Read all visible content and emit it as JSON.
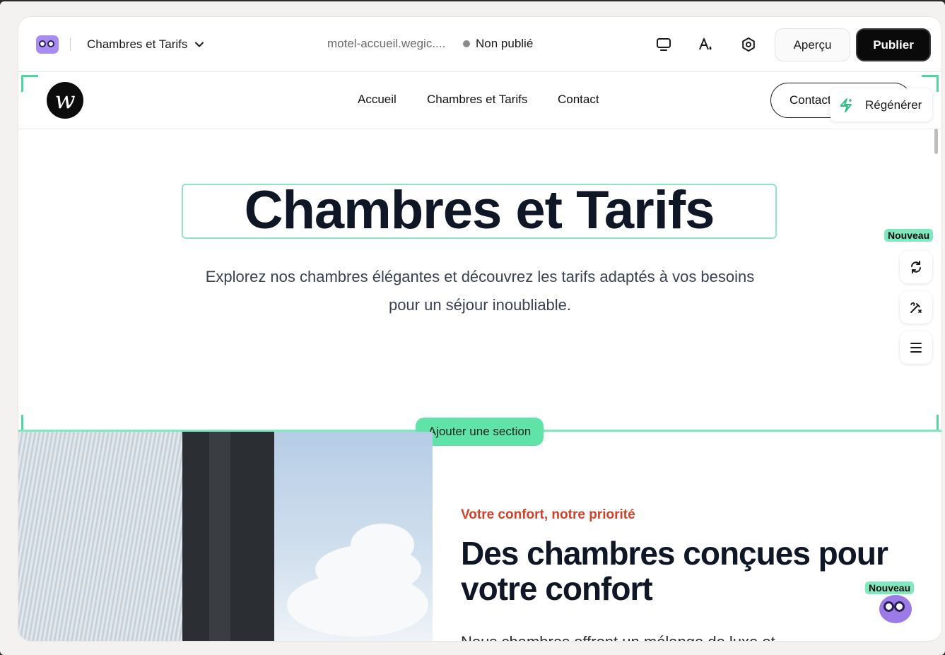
{
  "topbar": {
    "page_name": "Chambres et Tarifs",
    "domain": "motel-accueil.wegic....",
    "status": "Non publié",
    "preview_label": "Aperçu",
    "publish_label": "Publier"
  },
  "site": {
    "nav": [
      "Accueil",
      "Chambres et Tarifs",
      "Contact"
    ],
    "contact_button": "Contact",
    "regenerate_label": "Régénérer",
    "hero": {
      "title": "Chambres et Tarifs",
      "subtitle": "Explorez nos chambres élégantes et découvrez les tarifs adaptés à vos besoins pour un séjour inoubliable."
    },
    "add_section_label": "Ajouter une section",
    "section": {
      "eyebrow": "Votre confort, notre priorité",
      "title": "Des chambres conçues pour votre confort",
      "body": "Nous chambres offrent un mélange de luxe et..."
    }
  },
  "rail": {
    "badge_new": "Nouveau",
    "buttons": [
      "sync-icon",
      "magic-pen-icon",
      "menu-icon"
    ]
  },
  "assistant": {
    "badge_new": "Nouveau"
  },
  "colors": {
    "accent": "#5fe3a9",
    "publish_bg": "#0a0a0a",
    "eyebrow": "#d2402a",
    "heading": "#0f1626"
  }
}
